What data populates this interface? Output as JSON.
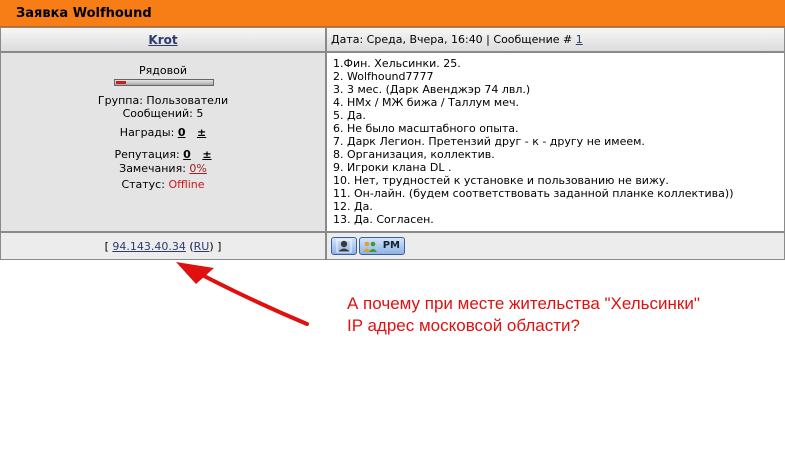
{
  "title": "Заявка Wolfhound",
  "post": {
    "author": "Krot",
    "date_prefix": "Дата: Среда, Вчера, 16:40 | Сообщение #",
    "message_number": "1",
    "profile": {
      "rank": "Рядовой",
      "rank_progress": 0.1,
      "group": "Группа: Пользователи",
      "posts": "Сообщений: 5",
      "awards_label": "Награды:",
      "awards_value": "0",
      "awards_plus": "±",
      "reputation_label": "Репутация:",
      "reputation_value": "0",
      "reputation_plus": "±",
      "warnings_label": "Замечания:",
      "warnings_value": "0%",
      "status_label": "Статус:",
      "status_value": "Offline"
    },
    "lines": [
      "1.Фин. Хельсинки. 25.",
      "2. Wolfhound7777",
      "3. 3 мес. (Дарк Авенджэр 74 лвл.)",
      "4. HMx / МЖ бижа / Таллум меч.",
      "5. Да.",
      "6. Не было масштабного опыта.",
      "7. Дарк Легион. Претензий друг - к - другу не имеем.",
      "8. Организация, коллектив.",
      "9. Игроки клана DL .",
      "10. Нет, трудностей к установке и пользованию не вижу.",
      "11. Он-лайн. (будем соответствовать заданной планке коллектива))",
      "12. Да.",
      "13. Да. Согласен."
    ],
    "footer": {
      "bracket_open": "[",
      "ip": "94.143.40.34",
      "country_open": "(",
      "country": "RU",
      "country_close": ")",
      "bracket_close": "]",
      "pm_label": "PM"
    }
  },
  "annotation": {
    "line1": "А почему при месте жительства \"Хельсинки\"",
    "line2": "IP адрес московсой области?"
  },
  "colors": {
    "title_bar": "#f77e16",
    "annotation": "#e11010",
    "link": "#2f3b6d",
    "offline": "#d01515"
  }
}
